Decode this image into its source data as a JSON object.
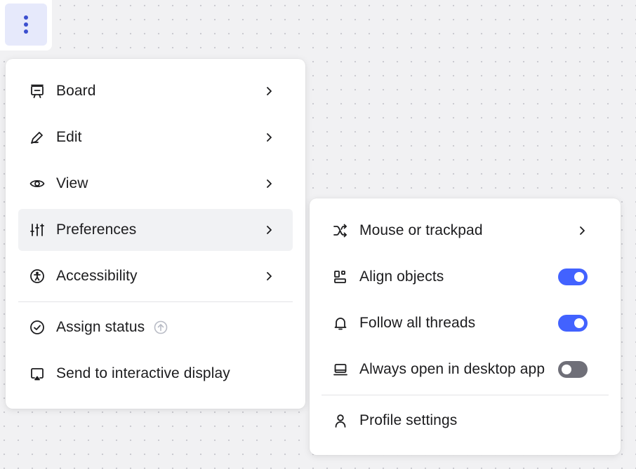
{
  "colors": {
    "accent": "#4262ff",
    "toggle_off": "#6f6f78",
    "text": "#1c1c1e",
    "hover_bg": "#f1f2f4",
    "kebab_bg": "#e6e9fb"
  },
  "kebab": {
    "icon": "more-vertical-icon"
  },
  "main_menu": {
    "items": [
      {
        "label": "Board",
        "icon": "board-icon"
      },
      {
        "label": "Edit",
        "icon": "pen-icon"
      },
      {
        "label": "View",
        "icon": "eye-icon"
      },
      {
        "label": "Preferences",
        "icon": "sliders-icon",
        "active": true
      },
      {
        "label": "Accessibility",
        "icon": "accessibility-icon"
      }
    ],
    "extra": [
      {
        "label": "Assign status",
        "icon": "check-circle-icon",
        "badge": "upgrade-arrow-icon"
      },
      {
        "label": "Send to interactive display",
        "icon": "cast-display-icon"
      }
    ]
  },
  "sub_menu": {
    "items": [
      {
        "label": "Mouse or trackpad",
        "icon": "shuffle-icon",
        "control": "chevron"
      },
      {
        "label": "Align objects",
        "icon": "align-objects-icon",
        "control": "toggle",
        "on": true
      },
      {
        "label": "Follow all threads",
        "icon": "bell-icon",
        "control": "toggle",
        "on": true
      },
      {
        "label": "Always open in desktop app",
        "icon": "laptop-icon",
        "control": "toggle",
        "on": false
      }
    ],
    "extra": [
      {
        "label": "Profile settings",
        "icon": "user-icon"
      }
    ]
  }
}
